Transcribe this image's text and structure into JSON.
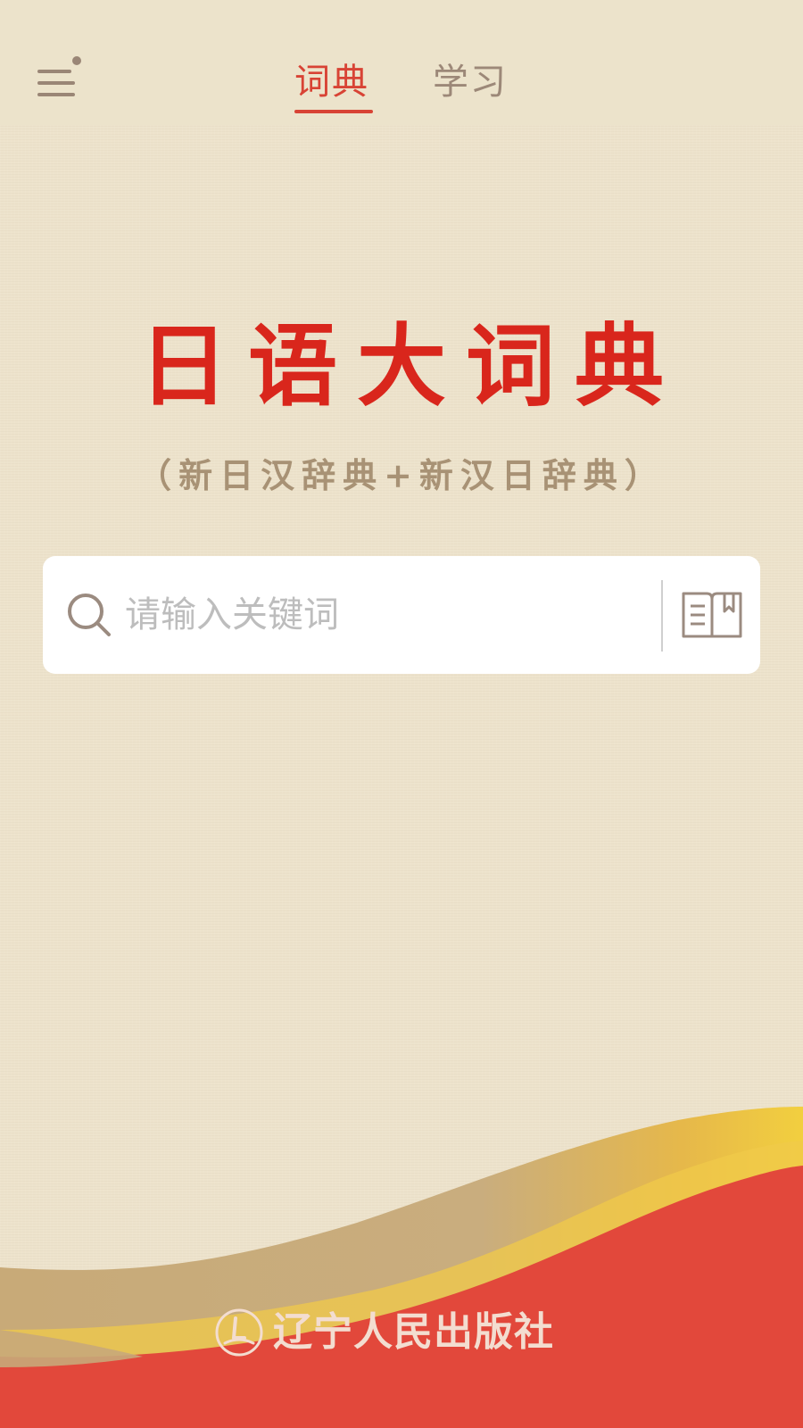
{
  "header": {
    "tabs": [
      {
        "label": "词典",
        "active": true
      },
      {
        "label": "学习",
        "active": false
      }
    ]
  },
  "hero": {
    "title": "日语大词典",
    "subtitle": "（新日汉辞典+新汉日辞典）"
  },
  "search": {
    "placeholder": "请输入关键词",
    "value": ""
  },
  "footer": {
    "publisher": "辽宁人民出版社"
  },
  "colors": {
    "background": "#ede3cc",
    "accent": "#d84335",
    "title": "#d9261c",
    "subtitle": "#a89275",
    "wave_red": "#e2483b",
    "wave_gold": "#c9ae80",
    "wave_yellow": "#f0c94a"
  },
  "icons": {
    "menu": "menu-icon",
    "search": "search-icon",
    "book": "book-icon",
    "logo": "publisher-logo-icon"
  }
}
